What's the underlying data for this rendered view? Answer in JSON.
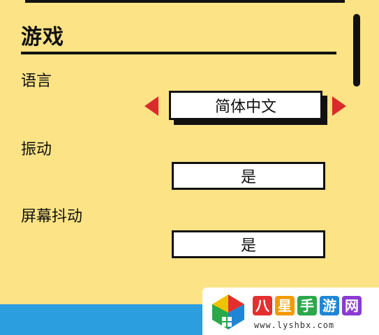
{
  "section": {
    "title": "游戏"
  },
  "settings": {
    "language": {
      "label": "语言",
      "value": "简体中文"
    },
    "vibration": {
      "label": "振动",
      "value": "是"
    },
    "screen_shake": {
      "label": "屏幕抖动",
      "value": "是"
    }
  },
  "watermark": {
    "name_chars": [
      "八",
      "星",
      "手",
      "游",
      "网"
    ],
    "url": "www.lyshbx.com"
  },
  "colors": {
    "background": "#fbe386",
    "arrow": "#d92b2b",
    "bottom_bar": "#2b9ee0"
  }
}
